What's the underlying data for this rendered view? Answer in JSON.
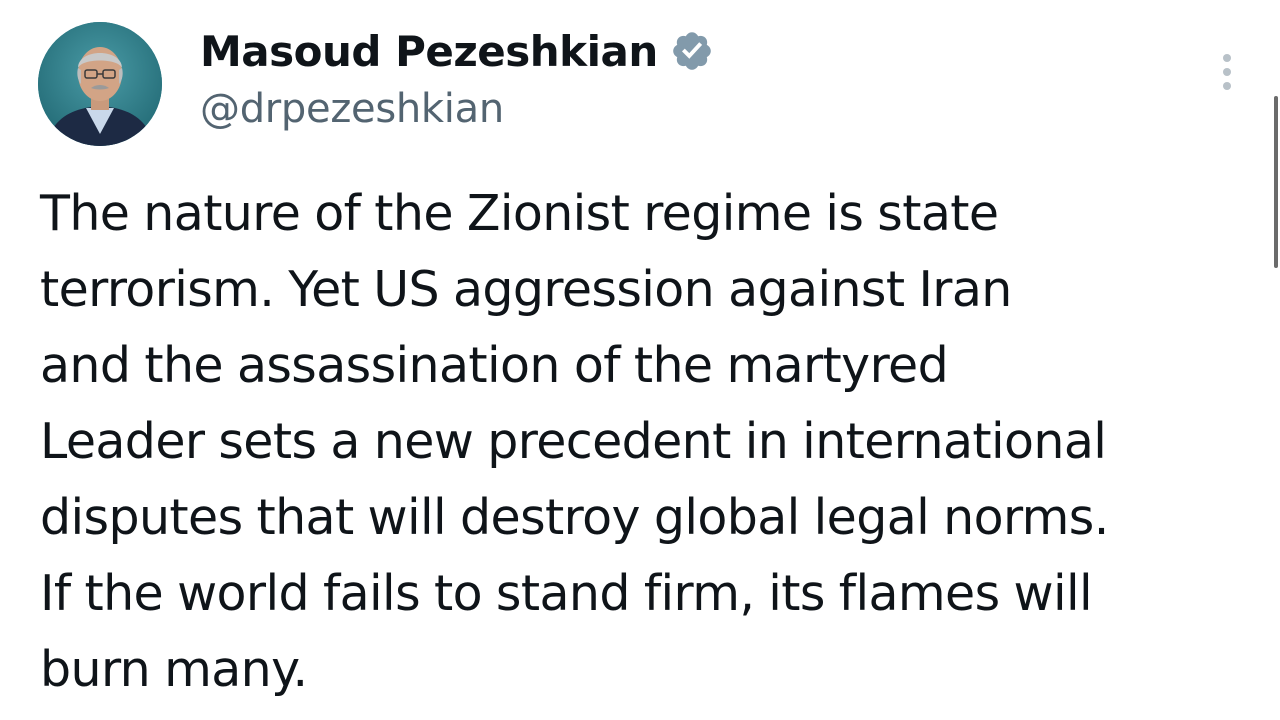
{
  "author": {
    "display_name": "Masoud Pezeshkian",
    "handle": "@drpezeshkian",
    "verified": true,
    "avatar_icon": "profile-photo",
    "verified_icon": "verified-badge-icon"
  },
  "menu": {
    "icon": "more-options-icon"
  },
  "tweet": {
    "lines": [
      "The nature of the Zionist regime is state",
      "terrorism. Yet US aggression against Iran",
      "and the assassination of the martyred",
      "Leader sets a new precedent in international",
      "disputes that will destroy global legal norms.",
      "If the world fails to stand firm, its flames will",
      "burn many."
    ]
  },
  "colors": {
    "text": "#0f1419",
    "secondary": "#536471",
    "badge": "#829aab",
    "background": "#ffffff"
  }
}
